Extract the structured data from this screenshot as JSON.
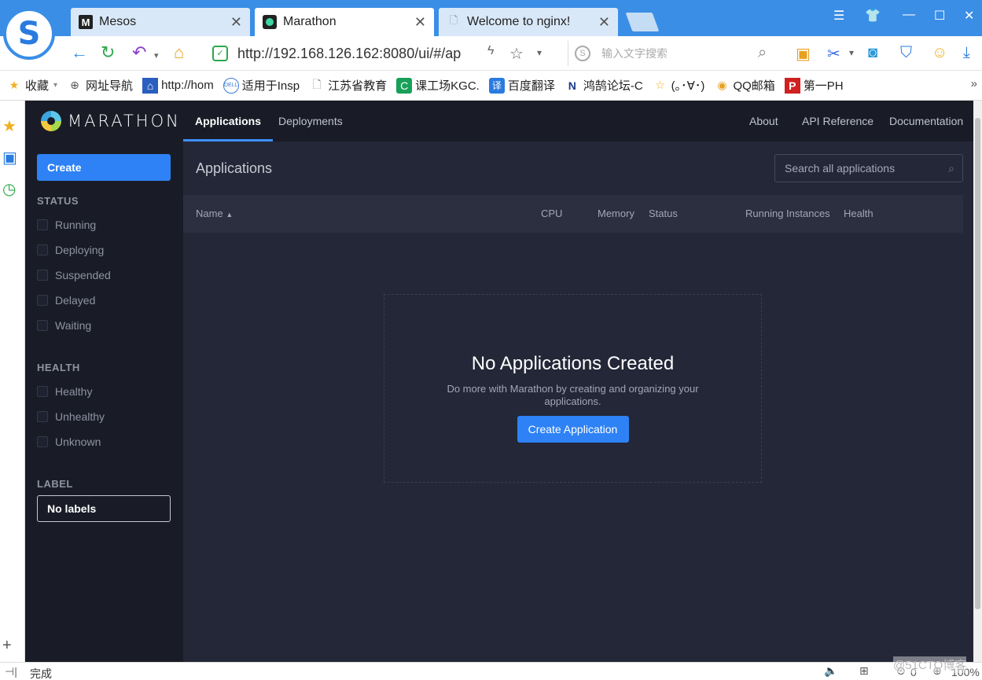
{
  "browser": {
    "tabs": [
      {
        "title": "Mesos",
        "icon": "M"
      },
      {
        "title": "Marathon",
        "icon": "marathon-logo"
      },
      {
        "title": "Welcome to nginx!",
        "icon": "page-icon"
      }
    ],
    "url_text": "http://192.168.126.162:8080/ui/#/ap",
    "search_placeholder": "输入文字搜索",
    "bookmarks": [
      {
        "label": "收藏",
        "icon": "star-icon"
      },
      {
        "label": "网址导航",
        "icon": "globe-icon"
      },
      {
        "label": "http://hom",
        "icon": "home-icon"
      },
      {
        "label": "适用于Insp",
        "icon": "dell-icon"
      },
      {
        "label": "江苏省教育",
        "icon": "page-icon"
      },
      {
        "label": "课工场KGC.",
        "icon": "kgc-icon"
      },
      {
        "label": "百度翻译",
        "icon": "translate-icon"
      },
      {
        "label": "鸿鹄论坛-C",
        "icon": "n-icon"
      },
      {
        "label": "(｡･∀･)",
        "icon": "star-icon"
      },
      {
        "label": "QQ邮箱",
        "icon": "qq-icon"
      },
      {
        "label": "第一PH",
        "icon": "p-icon"
      }
    ],
    "status_text": "完成",
    "status_right": "0",
    "zoom": "100%",
    "watermark": "@51CTO博客"
  },
  "marathon": {
    "brand": "MARATHON",
    "nav": {
      "applications": "Applications",
      "deployments": "Deployments"
    },
    "right_nav": {
      "about": "About",
      "api": "API Reference",
      "docs": "Documentation"
    },
    "create_label": "Create",
    "status_heading": "STATUS",
    "status_filters": [
      "Running",
      "Deploying",
      "Suspended",
      "Delayed",
      "Waiting"
    ],
    "health_heading": "HEALTH",
    "health_filters": [
      "Healthy",
      "Unhealthy",
      "Unknown"
    ],
    "label_heading": "LABEL",
    "labels_value": "No labels",
    "page_title": "Applications",
    "search_placeholder": "Search all applications",
    "columns": {
      "name": "Name",
      "cpu": "CPU",
      "memory": "Memory",
      "status": "Status",
      "running": "Running Instances",
      "health": "Health"
    },
    "empty": {
      "title": "No Applications Created",
      "description": "Do more with Marathon by creating and organizing your applications.",
      "button": "Create Application"
    }
  }
}
